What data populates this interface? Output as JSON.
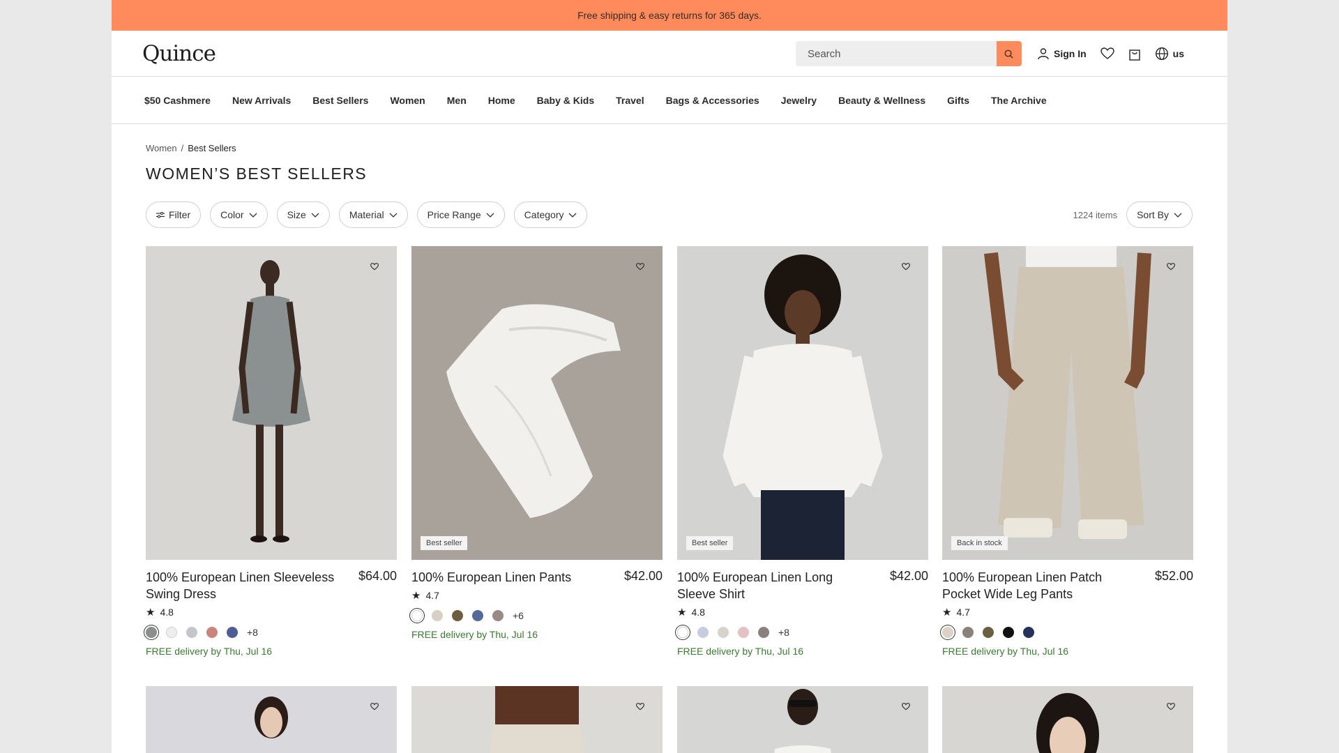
{
  "promo": {
    "text": "Free shipping & easy returns for 365 days."
  },
  "header": {
    "logo": "Quince",
    "search_placeholder": "Search",
    "sign_in": "Sign In",
    "region": "us"
  },
  "nav": {
    "items": [
      "$50 Cashmere",
      "New Arrivals",
      "Best Sellers",
      "Women",
      "Men",
      "Home",
      "Baby & Kids",
      "Travel",
      "Bags & Accessories",
      "Jewelry",
      "Beauty & Wellness",
      "Gifts",
      "The Archive"
    ]
  },
  "breadcrumb": {
    "parent": "Women",
    "separator": "/",
    "current": "Best Sellers"
  },
  "page_title": "WOMEN’S BEST SELLERS",
  "filters": {
    "filter_label": "Filter",
    "chips": [
      "Color",
      "Size",
      "Material",
      "Price Range",
      "Category"
    ],
    "item_count": "1224 items",
    "sort_label": "Sort By"
  },
  "colors": {
    "accent": "#ff8a5b",
    "delivery": "#3b7a32"
  },
  "products": [
    {
      "name": "100% European Linen Sleeveless Swing Dress",
      "price": "$64.00",
      "rating": "4.8",
      "badge": "",
      "swatches": [
        "#8a8e8c",
        "#eeeeee",
        "#c3c7cc",
        "#c9857c",
        "#4f5d96"
      ],
      "more": "+8",
      "delivery": "FREE delivery by Thu, Jul 16"
    },
    {
      "name": "100% European Linen Pants",
      "price": "$42.00",
      "rating": "4.7",
      "badge": "Best seller",
      "swatches": [
        "#ffffff",
        "#d8cfc7",
        "#6b5f42",
        "#55689a",
        "#9a8a86"
      ],
      "more": "+6",
      "delivery": "FREE delivery by Thu, Jul 16"
    },
    {
      "name": "100% European Linen Long Sleeve Shirt",
      "price": "$42.00",
      "rating": "4.8",
      "badge": "Best seller",
      "swatches": [
        "#ffffff",
        "#c5cde0",
        "#d8d2cc",
        "#e2c2c2",
        "#8a817e"
      ],
      "more": "+8",
      "delivery": "FREE delivery by Thu, Jul 16"
    },
    {
      "name": "100% European Linen Patch Pocket Wide Leg Pants",
      "price": "$52.00",
      "rating": "4.7",
      "badge": "Back in stock",
      "swatches": [
        "#dcd2c6",
        "#8c8178",
        "#6b5f42",
        "#111111",
        "#27325a"
      ],
      "more": "",
      "delivery": "FREE delivery by Thu, Jul 16"
    }
  ]
}
